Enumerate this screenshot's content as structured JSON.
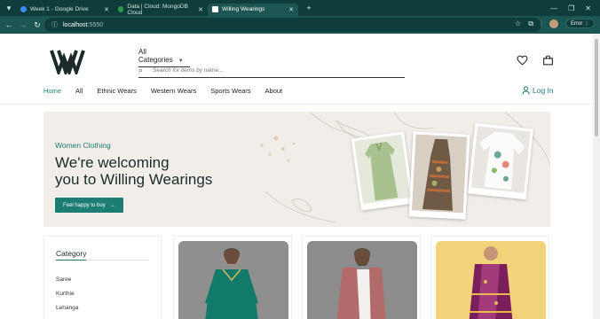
{
  "browser": {
    "tabs": [
      {
        "label": "Week 1 - Google Drive",
        "color": "#3b8cf0"
      },
      {
        "label": "Data | Cloud: MongoDB Cloud",
        "color": "#2e9b4a"
      },
      {
        "label": "Willing Wearings",
        "color": "#ffffff"
      }
    ],
    "new_tab_label": "+",
    "url_host": "localhost",
    "url_port": ":5550",
    "error_label": "Error"
  },
  "header": {
    "logo_text": "WW",
    "category_select": "All Categories",
    "search_placeholder": "Search for items by name...",
    "icons": [
      "heart-icon",
      "bag-icon"
    ]
  },
  "nav": {
    "items": [
      "Home",
      "All",
      "Ethnic Wears",
      "Western Wears",
      "Sports Wears",
      "About"
    ],
    "login_label": "Log In"
  },
  "hero": {
    "eyebrow": "Women Clothing",
    "headline_line1": "We're welcoming",
    "headline_line2": "you to Willing Wearings",
    "cta_label": "Feel happy to buy",
    "cta_icon": "arrow-right-icon"
  },
  "sidebar": {
    "title": "Category",
    "options": [
      "Saree",
      "Kurthie",
      "Lehanga"
    ]
  },
  "colors": {
    "accent": "#1c7d74",
    "browser_dark": "#0f3d3b",
    "browser_bar": "#1d5553",
    "hero_bg": "#f1eeea"
  }
}
